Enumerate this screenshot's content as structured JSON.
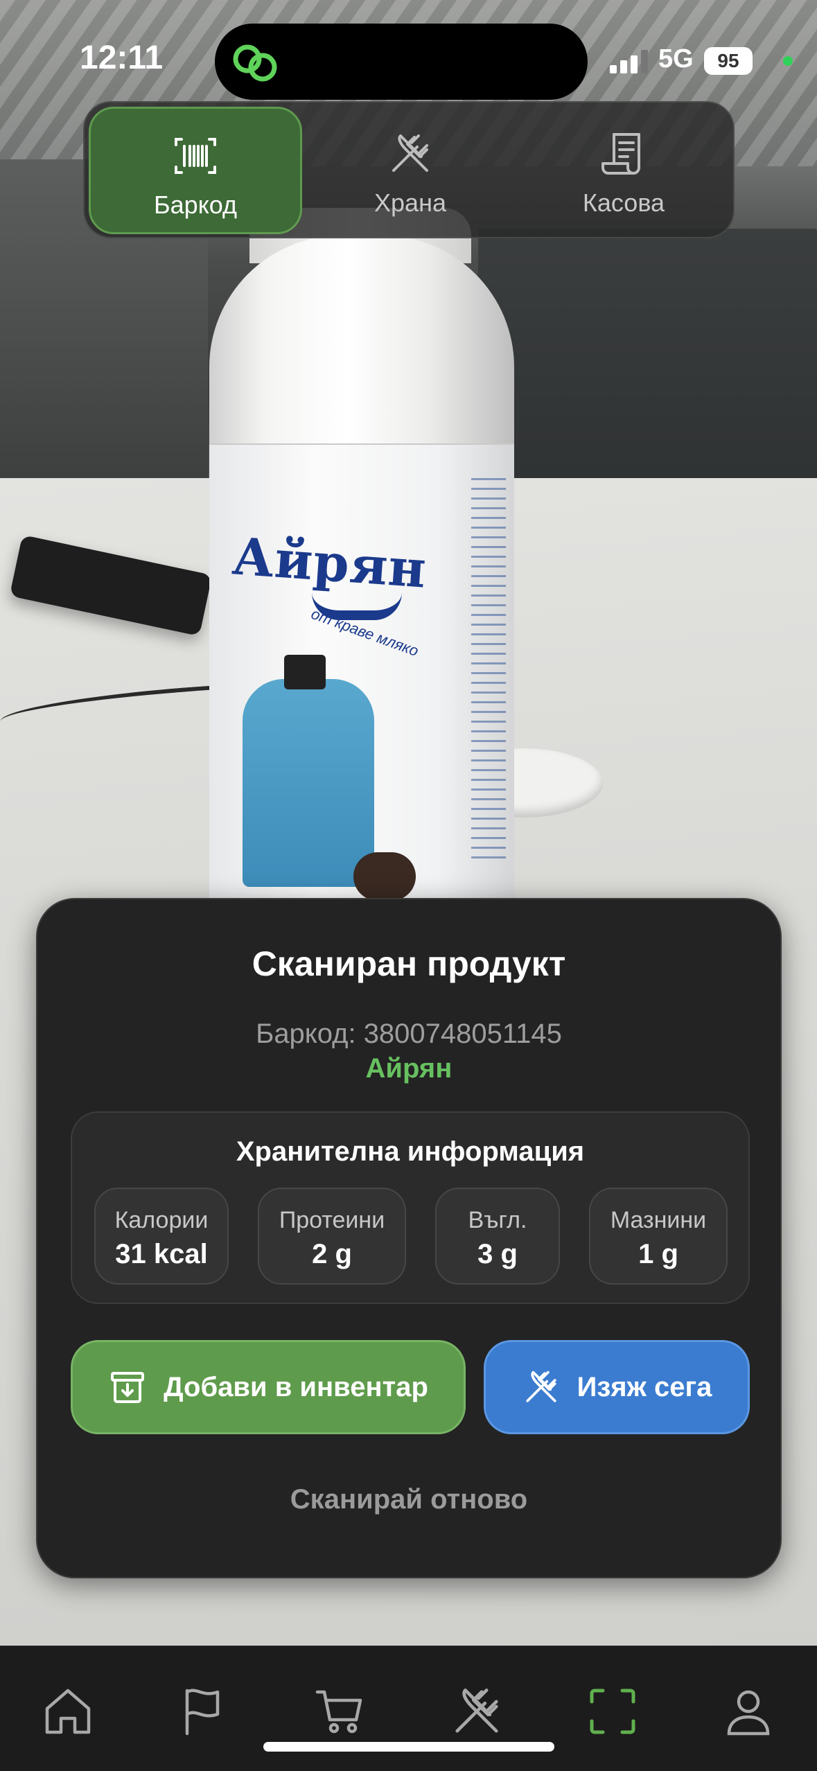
{
  "status_bar": {
    "time": "12:11",
    "network": "5G",
    "battery": "95"
  },
  "mode_tabs": [
    {
      "label": "Баркод",
      "icon": "barcode-icon",
      "active": true
    },
    {
      "label": "Храна",
      "icon": "fork-knife-icon",
      "active": false
    },
    {
      "label": "Касова",
      "icon": "receipt-icon",
      "active": false
    }
  ],
  "result": {
    "title": "Сканиран продукт",
    "barcode_line": "Баркод: 3800748051145",
    "product_name": "Айрян",
    "nutrition": {
      "title": "Хранителна информация",
      "items": [
        {
          "label": "Калории",
          "value": "31 kcal"
        },
        {
          "label": "Протеини",
          "value": "2 g"
        },
        {
          "label": "Въгл.",
          "value": "3 g"
        },
        {
          "label": "Мазнини",
          "value": "1 g"
        }
      ]
    },
    "add_button": "Добави в инвентар",
    "eat_button": "Изяж сега",
    "rescan": "Сканирай отново"
  },
  "product_label": {
    "brand": "Айрян",
    "tagline": "от краве мляко"
  },
  "bottom_nav": [
    {
      "icon": "home-icon"
    },
    {
      "icon": "flag-icon"
    },
    {
      "icon": "cart-icon"
    },
    {
      "icon": "fork-knife-icon"
    },
    {
      "icon": "scan-icon",
      "active": true
    },
    {
      "icon": "profile-icon"
    }
  ],
  "colors": {
    "accent_green": "#5f9b4c",
    "accent_blue": "#3b7cd0",
    "product_green": "#67c060"
  }
}
